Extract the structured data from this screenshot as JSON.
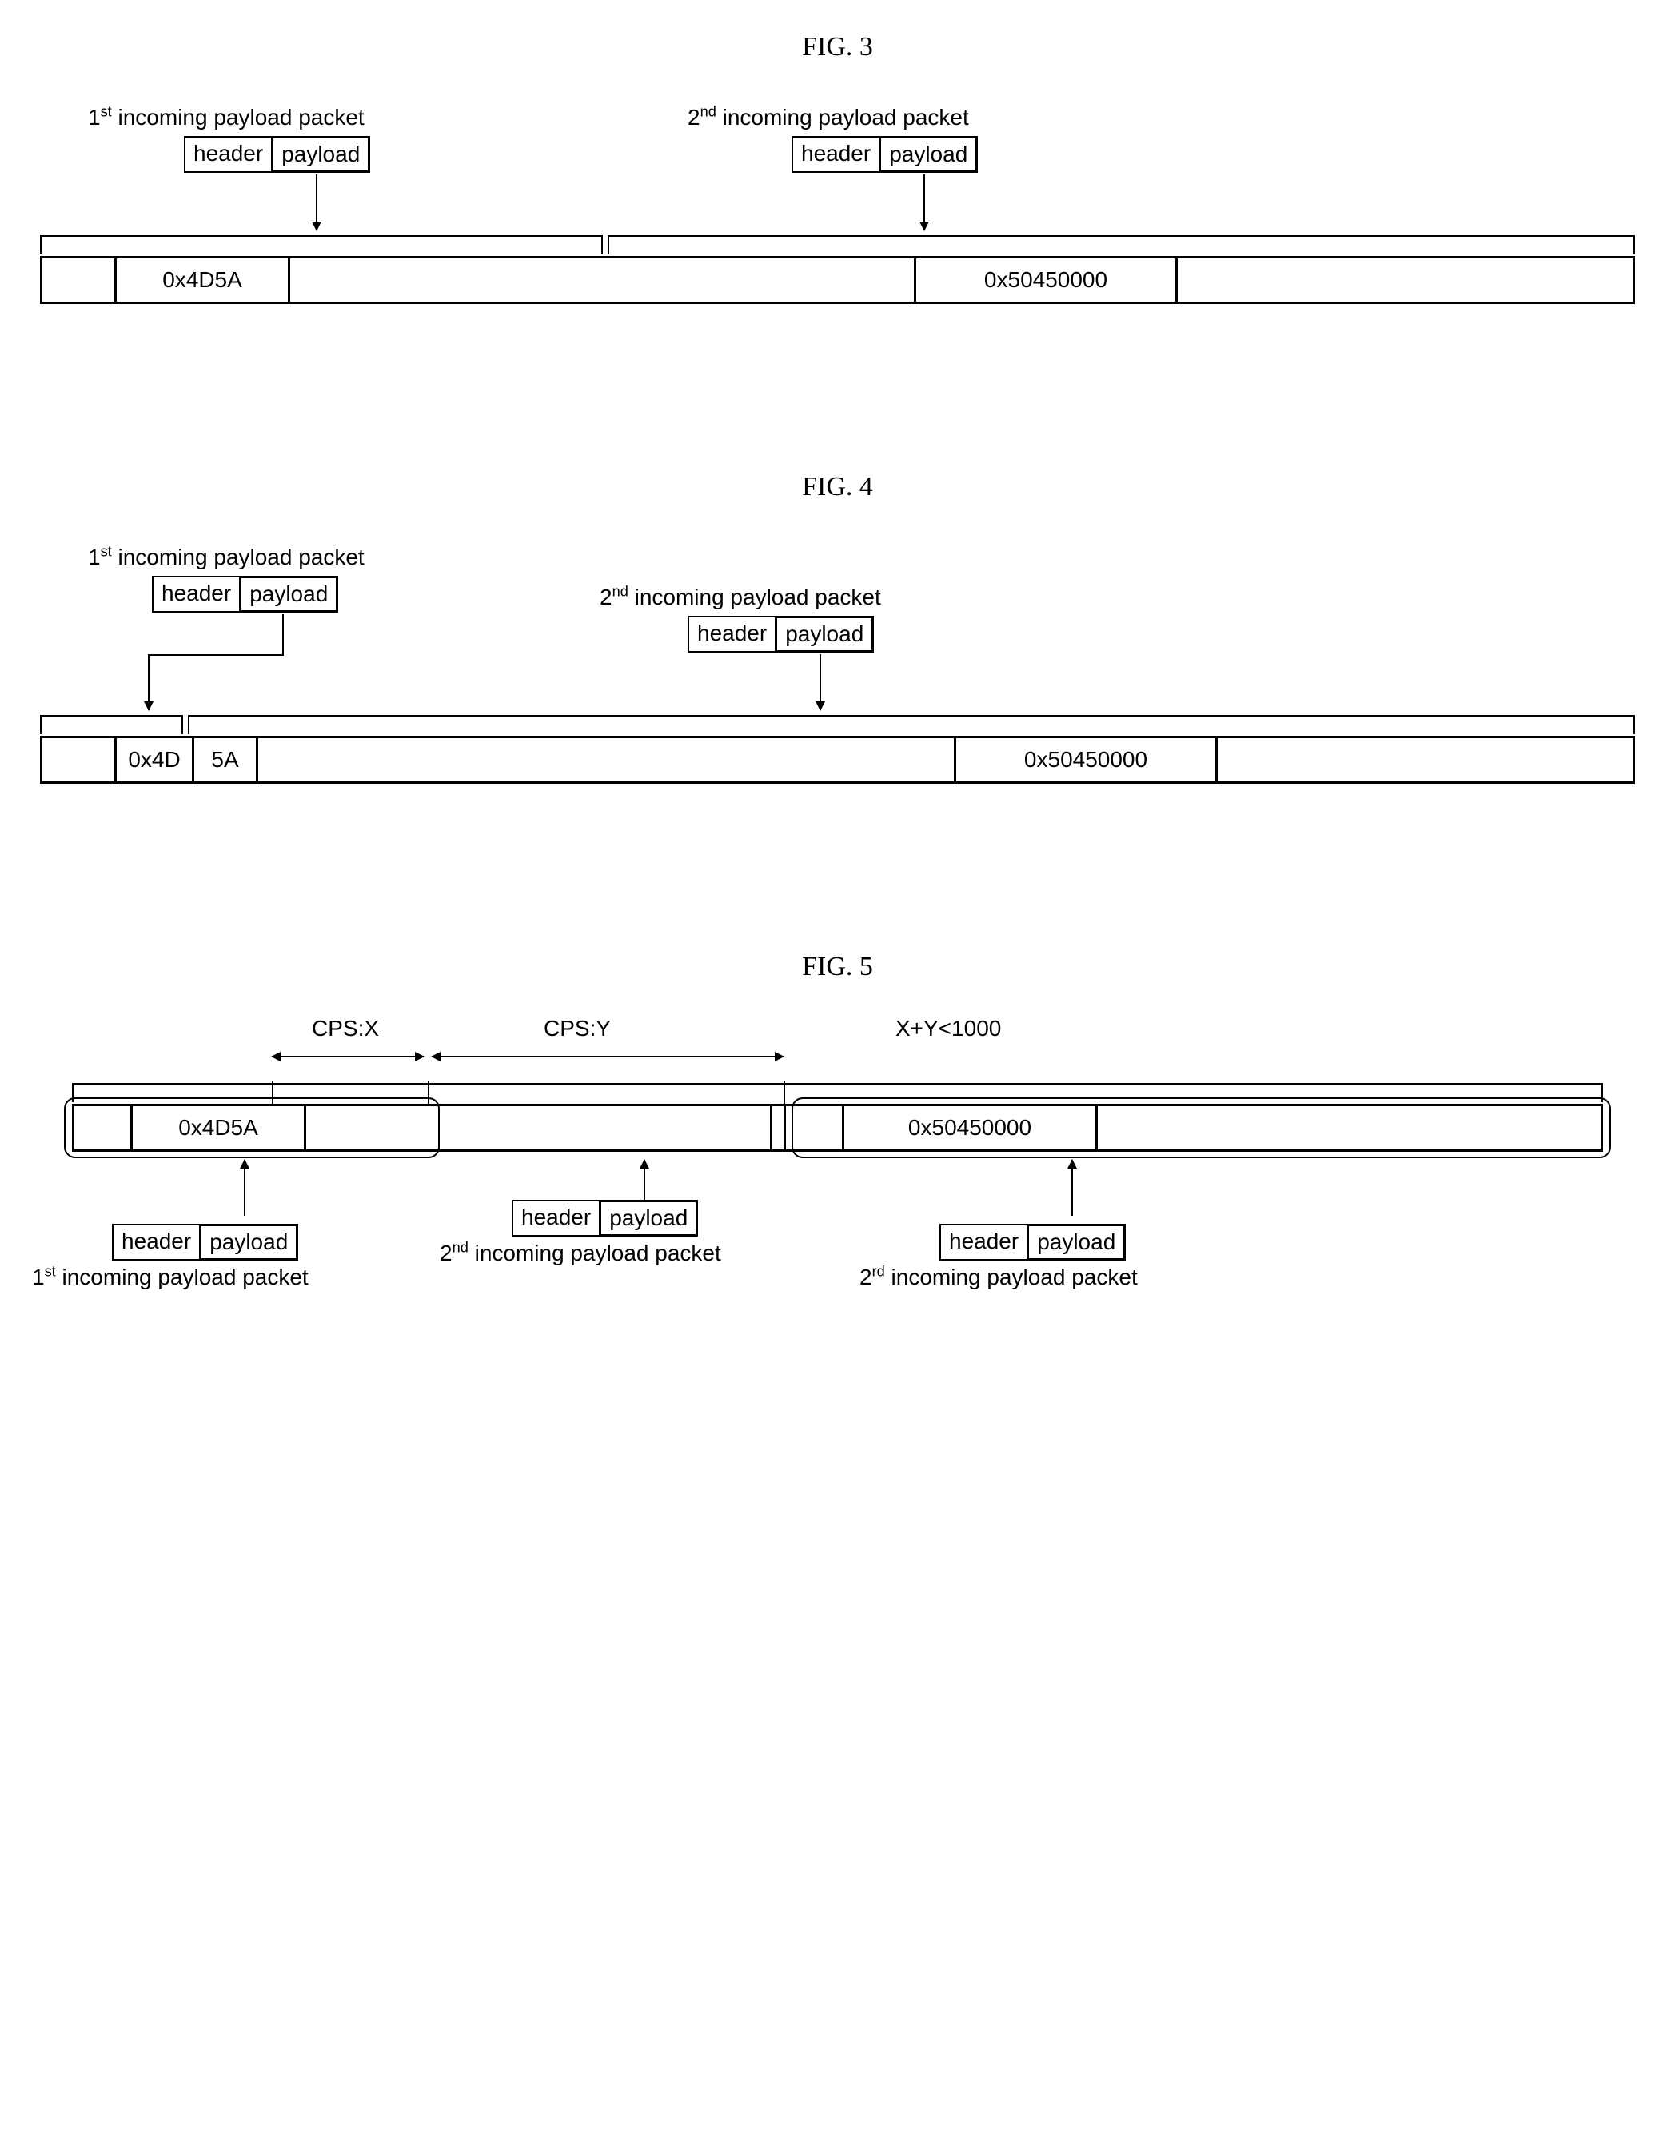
{
  "common": {
    "header_label": "header",
    "payload_label": "payload"
  },
  "fig3": {
    "title": "FIG. 3",
    "pkt1_label_html": "1<sup>st</sup> incoming payload packet",
    "pkt2_label_html": "2<sup>nd</sup> incoming payload packet",
    "cell1": "0x4D5A",
    "cell2": "0x50450000"
  },
  "fig4": {
    "title": "FIG. 4",
    "pkt1_label_html": "1<sup>st</sup> incoming payload packet",
    "pkt2_label_html": "2<sup>nd</sup> incoming payload packet",
    "cell1a": "0x4D",
    "cell1b": "5A",
    "cell2": "0x50450000"
  },
  "fig5": {
    "title": "FIG. 5",
    "cps_x": "CPS:X",
    "cps_y": "CPS:Y",
    "constraint": "X+Y<1000",
    "cell1": "0x4D5A",
    "cell2": "0x50450000",
    "pkt1_label_html": "1<sup>st</sup> incoming payload packet",
    "pkt2_label_html": "2<sup>nd</sup> incoming payload packet",
    "pkt3_label_html": "2<sup>rd</sup> incoming payload packet"
  }
}
